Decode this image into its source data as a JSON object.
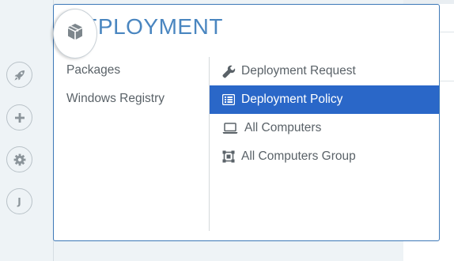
{
  "colors": {
    "accent": "#2a67c8",
    "title": "#4a86c0",
    "border": "#3d78b7",
    "text": "#5a6268",
    "icon": "#8b949a"
  },
  "rail": {
    "items": [
      {
        "icon": "package-icon",
        "active": true
      },
      {
        "icon": "rocket-icon"
      },
      {
        "icon": "plus-icon"
      },
      {
        "icon": "gear-icon"
      },
      {
        "icon": "user-initial-icon",
        "letter": "J"
      }
    ]
  },
  "flyout": {
    "title": "DEPLOYMENT",
    "left_items": [
      {
        "label": "Packages"
      },
      {
        "label": "Windows Registry"
      }
    ],
    "right_items": [
      {
        "label": "Deployment Request",
        "icon": "wrench-icon"
      },
      {
        "label": "Deployment Policy",
        "icon": "list-icon",
        "selected": true
      },
      {
        "label": "All Computers",
        "icon": "laptop-icon"
      },
      {
        "label": "All Computers Group",
        "icon": "computer-group-icon"
      }
    ]
  }
}
